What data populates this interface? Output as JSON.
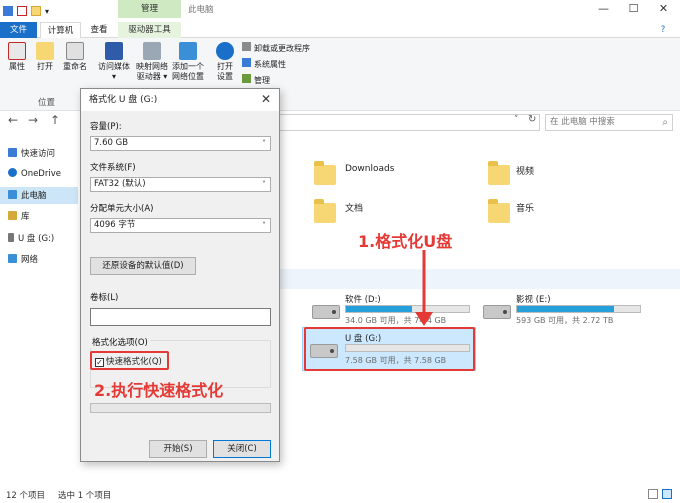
{
  "titlebar": {
    "manage_label": "管理",
    "window_title": "此电脑",
    "min": "—",
    "max": "☐",
    "close": "✕"
  },
  "tabs": {
    "file": "文件",
    "computer": "计算机",
    "view": "查看",
    "drive_tools": "驱动器工具"
  },
  "ribbon": {
    "props": "属性",
    "open": "打开",
    "rename": "重命名",
    "media_line1": "访问媒体",
    "media_line2": "▾",
    "mapnet_line1": "映射网络",
    "mapnet_line2": "驱动器 ▾",
    "addnet_line1": "添加一个",
    "addnet_line2": "网络位置",
    "open_settings_line1": "打开",
    "open_settings_line2": "设置",
    "uninstall": "卸载或更改程序",
    "sysprops": "系统属性",
    "manage": "管理",
    "group_location": "位置"
  },
  "nav": {
    "back": "←",
    "forward": "→",
    "up": "↑",
    "refresh": "↻",
    "chevron": "˅",
    "search_placeholder": "在 此电脑 中搜索",
    "search_icon": "⌕"
  },
  "sidebar": {
    "items": [
      "快速访问",
      "OneDrive",
      "此电脑",
      "库",
      "U 盘 (G:)",
      "网络"
    ]
  },
  "folders": {
    "downloads": "Downloads",
    "videos": "视频",
    "documents": "文档",
    "music": "音乐"
  },
  "drives": [
    {
      "name": "软件 (D:)",
      "free": "34.0 GB 可用，共 74.4 GB",
      "used_fraction": 0.54
    },
    {
      "name": "影视 (E:)",
      "free": "593 GB 可用，共 2.72 TB",
      "used_fraction": 0.79
    },
    {
      "name": "U 盘 (G:)",
      "free": "7.58 GB 可用，共 7.58 GB",
      "used_fraction": 0.0
    }
  ],
  "status": {
    "count": "12 个项目",
    "selected": "选中 1 个项目"
  },
  "dialog": {
    "title": "格式化 U 盘 (G:)",
    "capacity_label": "容量(P):",
    "capacity_value": "7.60 GB",
    "fs_label": "文件系统(F)",
    "fs_value": "FAT32 (默认)",
    "alloc_label": "分配单元大小(A)",
    "alloc_value": "4096 字节",
    "restore_btn": "还原设备的默认值(D)",
    "volume_label": "卷标(L)",
    "volume_value": "",
    "options_label": "格式化选项(O)",
    "quick_format": "快速格式化(Q)",
    "quick_checked": "✓",
    "start_btn": "开始(S)",
    "close_btn": "关闭(C)",
    "progress_fraction": 0.0
  },
  "annotations": {
    "step1": "1.格式化U盘",
    "step2": "2.执行快速格式化"
  }
}
